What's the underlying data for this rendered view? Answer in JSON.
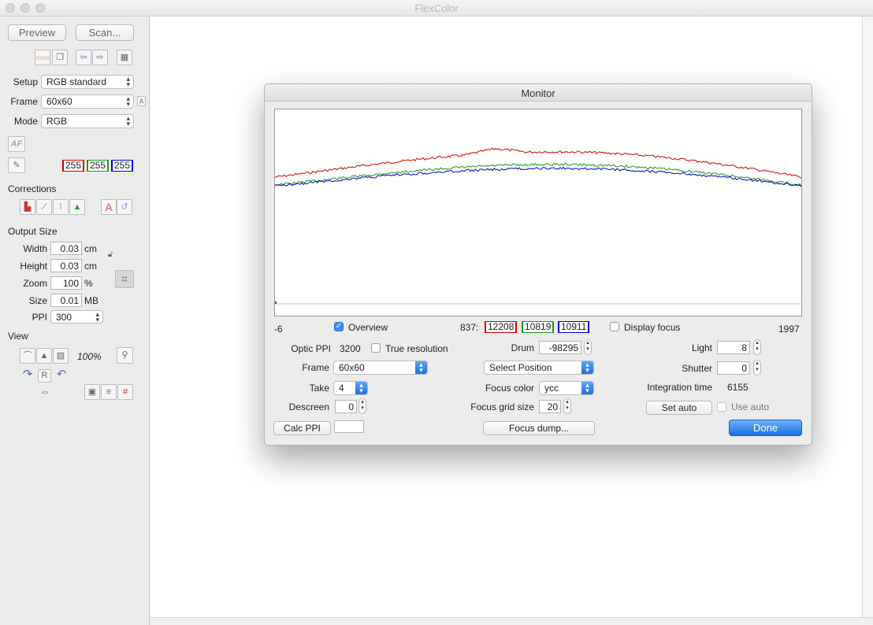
{
  "window": {
    "title": "FlexColor"
  },
  "sidebar": {
    "preview_label": "Preview",
    "scan_label": "Scan...",
    "setup_label": "Setup",
    "setup_value": "RGB standard",
    "frame_label": "Frame",
    "frame_value": "60x60",
    "frame_badge": "A",
    "mode_label": "Mode",
    "mode_value": "RGB",
    "af_label": "AF",
    "rgb_readout": [
      "255",
      "255",
      "255"
    ],
    "corrections_label": "Corrections",
    "output_size_label": "Output Size",
    "width_label": "Width",
    "width_value": "0.03",
    "width_unit": "cm",
    "height_label": "Height",
    "height_value": "0.03",
    "height_unit": "cm",
    "zoom_label": "Zoom",
    "zoom_value": "100",
    "zoom_unit": "%",
    "size_label": "Size",
    "size_value": "0.01",
    "size_unit": "MB",
    "ppi_label": "PPI",
    "ppi_value": "300",
    "view_label": "View",
    "view_zoom": "100%",
    "r_label": "R"
  },
  "monitor": {
    "title": "Monitor",
    "axis_min": "-6",
    "axis_max": "1997",
    "overview_label": "Overview",
    "overview_checked": true,
    "readout_position": "837:",
    "readout_values": [
      "12208",
      "10819",
      "10911"
    ],
    "display_focus_label": "Display focus",
    "optic_ppi_label": "Optic PPI",
    "optic_ppi_value": "3200",
    "true_resolution_label": "True resolution",
    "frame_label": "Frame",
    "frame_value": "60x60",
    "take_label": "Take",
    "take_value": "4",
    "descreen_label": "Descreen",
    "descreen_value": "0",
    "calc_ppi_label": "Calc PPI",
    "calc_ppi_value": "",
    "drum_label": "Drum",
    "drum_value": "-98295",
    "select_position_label": "Select Position",
    "focus_color_label": "Focus color",
    "focus_color_value": "ycc",
    "focus_grid_label": "Focus grid size",
    "focus_grid_value": "20",
    "focus_dump_label": "Focus dump...",
    "light_label": "Light",
    "light_value": "8",
    "shutter_label": "Shutter",
    "shutter_value": "0",
    "integration_label": "Integration time",
    "integration_value": "6155",
    "set_auto_label": "Set auto",
    "use_auto_label": "Use auto",
    "done_label": "Done"
  },
  "colors": {
    "red": "#d00000",
    "green": "#1a9a1a",
    "blue": "#0000c8",
    "accent": "#2a7ff0"
  }
}
